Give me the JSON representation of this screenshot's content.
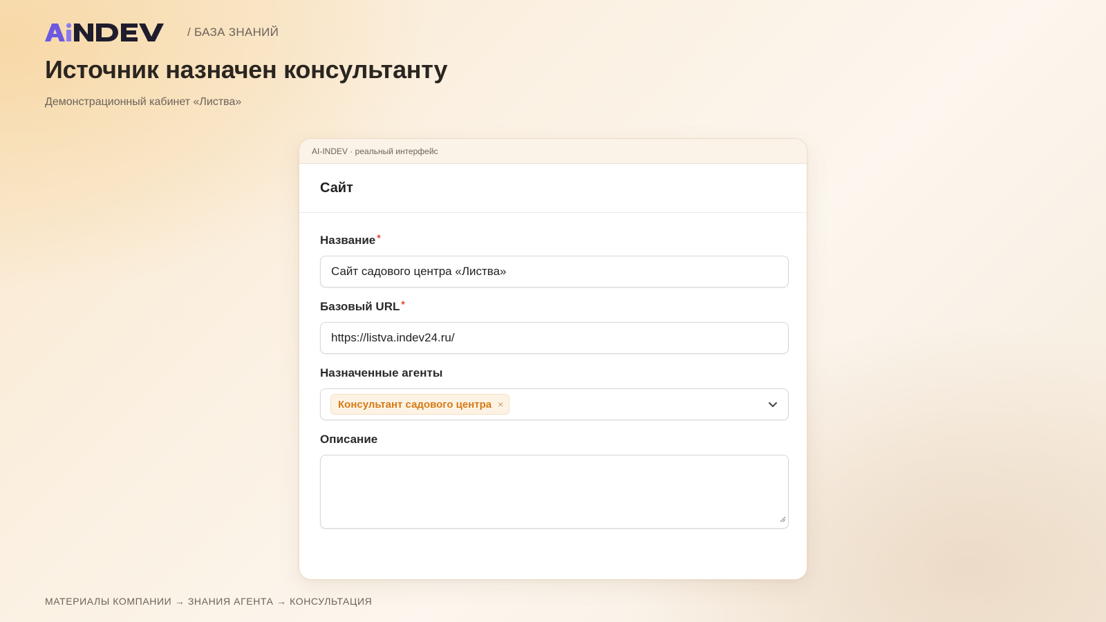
{
  "header": {
    "logo_text": "AINDEV",
    "section_label": "/ БАЗА ЗНАНИЙ"
  },
  "page": {
    "title": "Источник назначен консультанту",
    "subtitle": "Демонстрационный кабинет «Листва»"
  },
  "card": {
    "topbar_label": "AI-INDEV · реальный интерфейс",
    "title": "Сайт",
    "fields": {
      "name": {
        "label": "Название",
        "required_mark": "*",
        "value": "Сайт садового центра «Листва»"
      },
      "base_url": {
        "label": "Базовый URL",
        "required_mark": "*",
        "value": "https://listva.indev24.ru/"
      },
      "agents": {
        "label": "Назначенные агенты",
        "selected_tag": "Консультант садового центра",
        "tag_remove": "×"
      },
      "description": {
        "label": "Описание",
        "value": ""
      }
    }
  },
  "footer": {
    "flow": "МАТЕРИАЛЫ КОМПАНИИ → ЗНАНИЯ АГЕНТА → КОНСУЛЬТАЦИЯ"
  },
  "colors": {
    "accent_orange": "#d77a16",
    "logo_purple": "#6b5ae0",
    "logo_dark": "#1f1c2c",
    "required_red": "#e0452d"
  },
  "icons": {
    "dropdown": "chevron-down-icon",
    "resize": "resize-handle-icon"
  }
}
